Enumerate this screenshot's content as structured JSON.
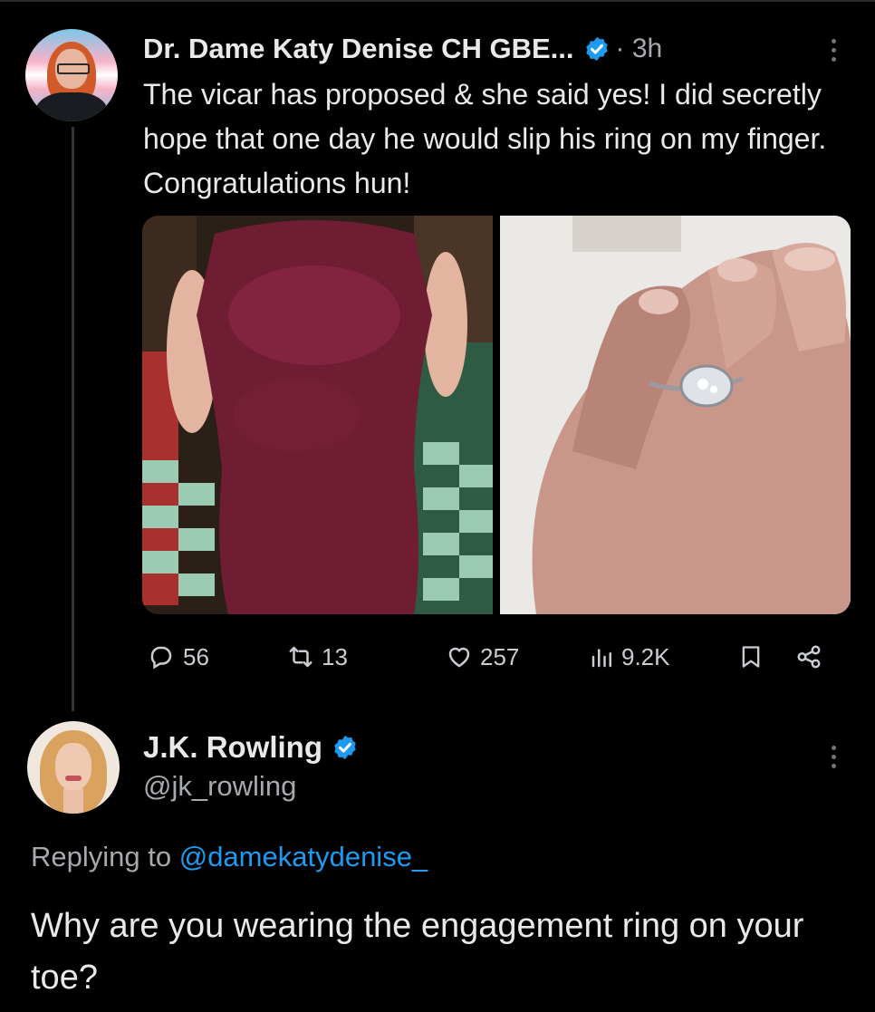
{
  "tweet1": {
    "display_name": "Dr. Dame Katy Denise CH GBE...",
    "time": "· 3h",
    "text": "The vicar has proposed & she said yes! I did secretly hope that one day he would slip his ring on my finger. Congratulations hun!",
    "stats": {
      "replies": "56",
      "reposts": "13",
      "likes": "257",
      "views": "9.2K"
    },
    "icons": [
      "verified-badge-icon",
      "more-icon",
      "reply-icon",
      "repost-icon",
      "like-icon",
      "views-icon",
      "bookmark-icon",
      "share-icon"
    ]
  },
  "tweet2": {
    "display_name": "J.K. Rowling",
    "handle": "@jk_rowling",
    "replying_prefix": "Replying to",
    "replying_mention": "@damekatydenise_",
    "text": "Why are you wearing the engagement ring on your toe?"
  },
  "colors": {
    "background": "#000000",
    "text": "#e7e9ea",
    "muted": "#a6a9ad",
    "accent": "#1d9bf0"
  }
}
